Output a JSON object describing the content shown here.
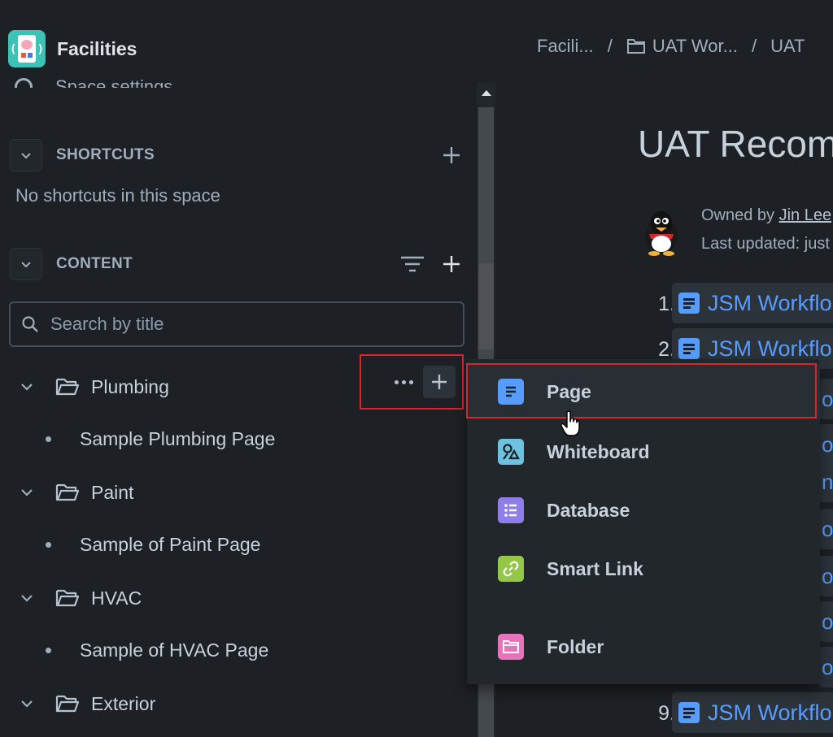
{
  "space": {
    "name": "Facilities"
  },
  "sidebar": {
    "cut_item_label": "Space settings",
    "shortcuts": {
      "title": "SHORTCUTS",
      "empty_text": "No shortcuts in this space"
    },
    "content": {
      "title": "CONTENT"
    },
    "search": {
      "placeholder": "Search by title"
    },
    "tree": [
      {
        "label": "Plumbing",
        "child": "Sample Plumbing Page"
      },
      {
        "label": "Paint",
        "child": "Sample of Paint Page"
      },
      {
        "label": "HVAC",
        "child": "Sample of HVAC Page"
      },
      {
        "label": "Exterior"
      }
    ]
  },
  "main": {
    "breadcrumbs": [
      "Facili...",
      "UAT Wor...",
      "UAT"
    ],
    "title": "UAT Recom",
    "owner_prefix": "Owned by ",
    "owner_name": "Jin Lee",
    "updated": "Last updated: just",
    "list": [
      {
        "num": "1.",
        "text": "JSM Workflo"
      },
      {
        "num": "2.",
        "text": "JSM Workflo"
      },
      {
        "num": "9.",
        "text": "JSM Workflo"
      }
    ],
    "stubs": [
      "o",
      "o",
      "ne",
      "o",
      "o",
      "o",
      "o",
      "o"
    ]
  },
  "create_menu": {
    "items": [
      {
        "label": "Page",
        "icon": "page-icon",
        "color": "#579dff"
      },
      {
        "label": "Whiteboard",
        "icon": "whiteboard-icon",
        "color": "#6cc3e0"
      },
      {
        "label": "Database",
        "icon": "database-icon",
        "color": "#8f7ee7"
      },
      {
        "label": "Smart Link",
        "icon": "smart-link-icon",
        "color": "#94c748"
      },
      {
        "label": "Folder",
        "icon": "folder-icon",
        "color": "#e774bb"
      }
    ]
  },
  "colors": {
    "background": "#1d2125",
    "highlight": "#d8252c",
    "link": "#579dff"
  }
}
